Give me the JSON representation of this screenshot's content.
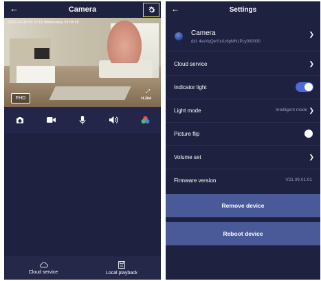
{
  "camera_screen": {
    "title": "Camera",
    "video": {
      "timestamp": "2023-03-30 03:10:18 Wednesday 09:54:48",
      "quality_label": "FHD",
      "codec_label": "H.264"
    },
    "toolbar": [
      {
        "icon": "camera-icon"
      },
      {
        "icon": "video-record-icon"
      },
      {
        "icon": "microphone-icon"
      },
      {
        "icon": "speaker-icon"
      },
      {
        "icon": "color-palette-icon"
      }
    ],
    "bottom_nav": [
      {
        "label": "Cloud service",
        "icon": "cloud-icon"
      },
      {
        "label": "Local playback",
        "icon": "sd-card-icon"
      }
    ]
  },
  "settings_screen": {
    "title": "Settings",
    "device": {
      "name": "Camera",
      "id": "did: 4vvXqQeYlxXz6pMN1Pcy000000"
    },
    "rows": [
      {
        "label": "Cloud service",
        "value": ""
      },
      {
        "label": "Indicator light",
        "toggle": "on"
      },
      {
        "label": "Light mode",
        "value": "Intelligent mode"
      },
      {
        "label": "Picture flip",
        "toggle": "off"
      },
      {
        "label": "Volume set",
        "value": ""
      },
      {
        "label": "Firmware version",
        "value": "V21.09.01.01"
      }
    ],
    "remove_label": "Remove device",
    "reboot_label": "Reboot device"
  },
  "colors": {
    "background": "#1f2140",
    "highlight_box": "#d7e93b",
    "toggle_on": "#4e6ad8",
    "button": "#4a5a98"
  }
}
